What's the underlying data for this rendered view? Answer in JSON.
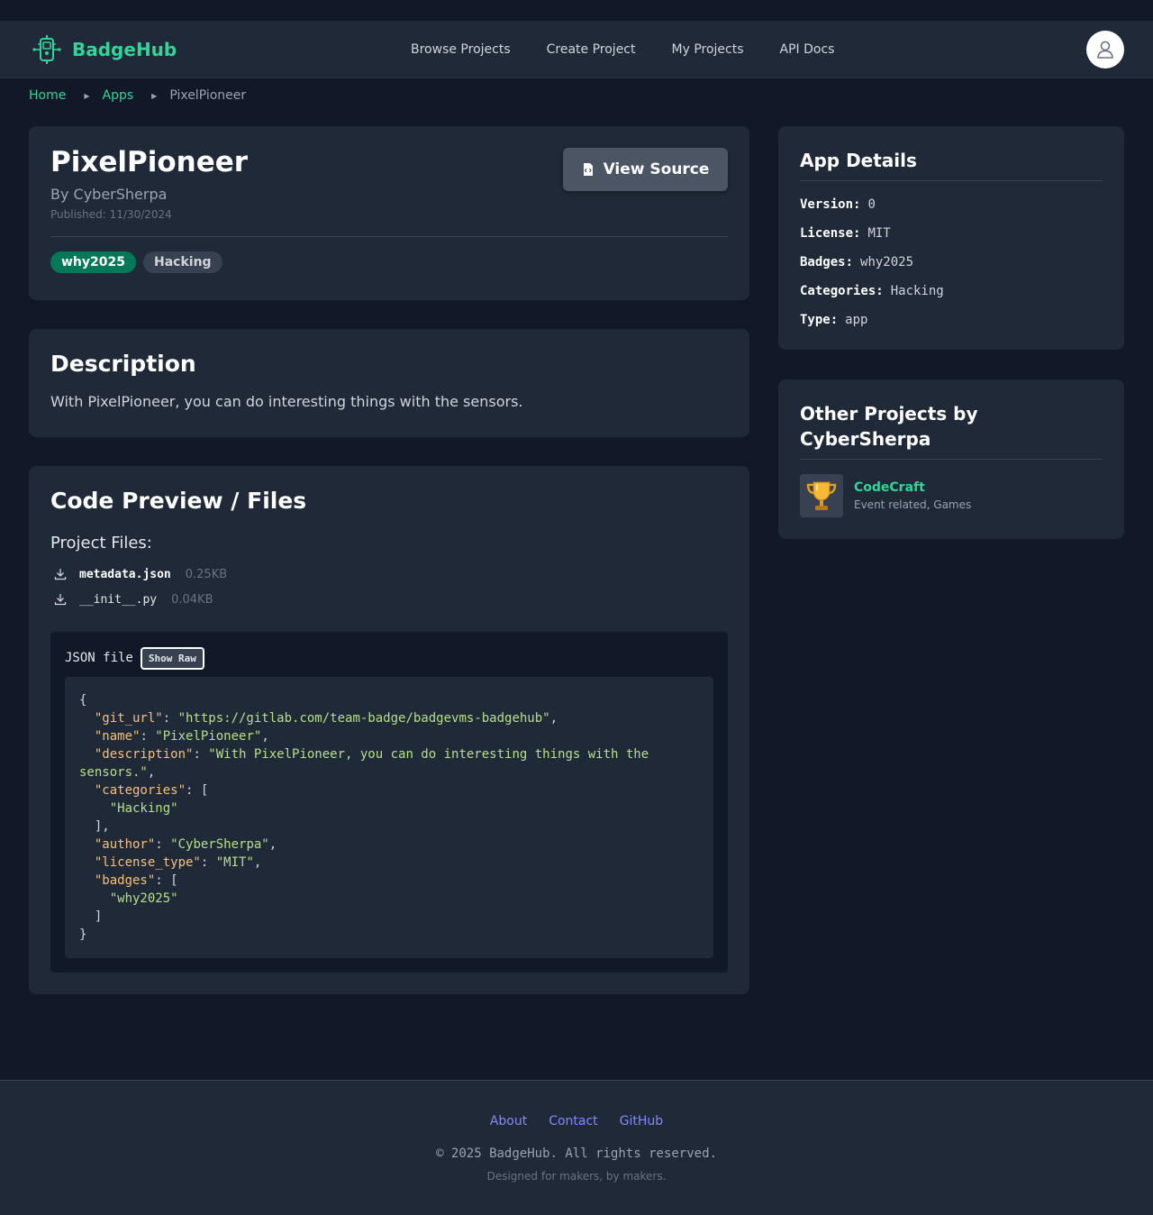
{
  "brand": {
    "name": "BadgeHub",
    "accent": "#34d399"
  },
  "nav": {
    "items": [
      {
        "label": "Browse Projects"
      },
      {
        "label": "Create Project"
      },
      {
        "label": "My Projects"
      },
      {
        "label": "API Docs"
      }
    ]
  },
  "breadcrumb": {
    "home": "Home",
    "apps": "Apps",
    "current": "PixelPioneer"
  },
  "app": {
    "title": "PixelPioneer",
    "byline": "By CyberSherpa",
    "published": "Published: 11/30/2024",
    "tags": [
      "why2025",
      "Hacking"
    ],
    "view_source_label": "View Source"
  },
  "description": {
    "heading": "Description",
    "text": "With PixelPioneer, you can do interesting things with the sensors."
  },
  "code": {
    "heading": "Code Preview / Files",
    "files_label": "Project Files:",
    "files": [
      {
        "name": "metadata.json",
        "size": "0.25KB"
      },
      {
        "name": "__init__.py",
        "size": "0.04KB"
      }
    ],
    "viewer_label": "JSON file",
    "show_raw_label": "Show Raw",
    "json_content": {
      "git_url": "https://gitlab.com/team-badge/badgevms-badgehub",
      "name": "PixelPioneer",
      "description": "With PixelPioneer, you can do interesting things with the sensors.",
      "categories": [
        "Hacking"
      ],
      "author": "CyberSherpa",
      "license_type": "MIT",
      "badges": [
        "why2025"
      ]
    }
  },
  "details": {
    "heading": "App Details",
    "rows": [
      {
        "label": "Version:",
        "value": "0"
      },
      {
        "label": "License:",
        "value": "MIT"
      },
      {
        "label": "Badges:",
        "value": "why2025"
      },
      {
        "label": "Categories:",
        "value": "Hacking"
      },
      {
        "label": "Type:",
        "value": "app"
      }
    ]
  },
  "other_projects": {
    "heading": "Other Projects by CyberSherpa",
    "items": [
      {
        "name": "CodeCraft",
        "categories": "Event related, Games",
        "icon": "trophy-icon"
      }
    ]
  },
  "footer": {
    "links": [
      "About",
      "Contact",
      "GitHub"
    ],
    "copyright": "© 2025 BadgeHub. All rights reserved.",
    "tagline": "Designed for makers, by makers."
  }
}
